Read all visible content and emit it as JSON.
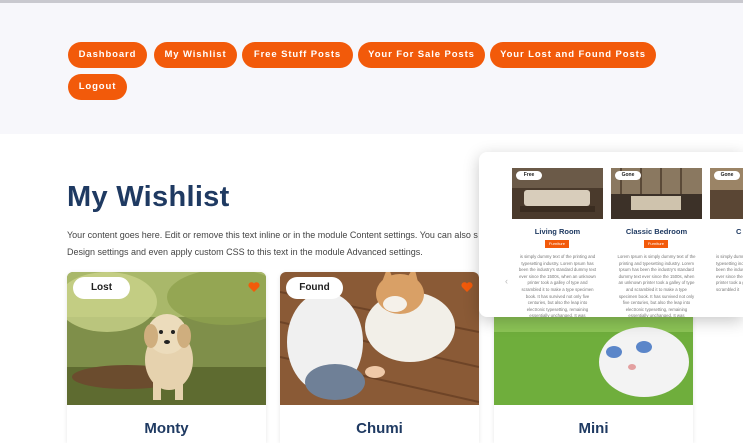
{
  "nav": {
    "items": [
      {
        "label": "Dashboard"
      },
      {
        "label": "My Wishlist"
      },
      {
        "label": "Free Stuff Posts"
      },
      {
        "label": "Your For Sale Posts"
      },
      {
        "label": "Your Lost and Found Posts"
      },
      {
        "label": "Logout"
      }
    ]
  },
  "page": {
    "title": "My Wishlist",
    "intro_line1": "Your content goes here. Edit or remove this text inline or in the module Content settings. You can also s",
    "intro_line2": "Design settings and even apply custom CSS to this text in the module Advanced settings."
  },
  "cards": [
    {
      "badge": "Lost",
      "name": "Monty"
    },
    {
      "badge": "Found",
      "name": "Chumi"
    },
    {
      "badge": "",
      "name": "Mini"
    }
  ],
  "carousel": {
    "items": [
      {
        "badge": "Free",
        "title": "Living Room",
        "button": "Furniture",
        "text": "is simply dummy text of the printing and typesetting industry. Lorem Ipsum has been the industry's standard dummy text ever since the 1500s, when an unknown printer took a galley of type and scrambled it to make a type specimen book. It has survived not only five centuries, but also the leap into electronic typesetting, remaining essentially unchanged. It was popularised in the 1960s with the release"
      },
      {
        "badge": "Gone",
        "title": "Classic Bedroom",
        "button": "Furniture",
        "text": "Lorem Ipsum is simply dummy text of the printing and typesetting industry. Lorem Ipsum has been the industry's standard dummy text ever since the 1500s, when an unknown printer took a galley of type and scrambled it to make a type specimen book. It has survived not only five centuries, but also the leap into electronic typesetting, remaining essentially unchanged. It was popularised in the 1960s"
      },
      {
        "badge": "Gone",
        "title": "C",
        "button": "",
        "text": "is simply dummy text of the printing and typesetting industry. Lorem Ipsum has been the industry's standard dummy text ever since the 1500s, when an unknown printer took a galley of type and scrambled it"
      }
    ]
  },
  "colors": {
    "accent": "#f25a0a",
    "heading": "#1f3a62",
    "nav_bg": "#f7f7fb"
  }
}
